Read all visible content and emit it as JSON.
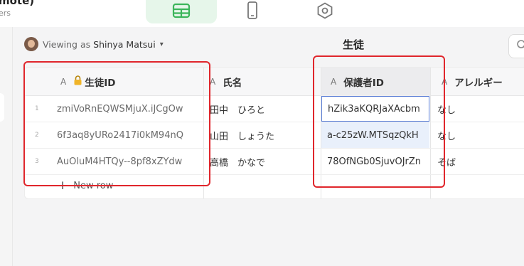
{
  "app": {
    "title": "mote)",
    "subtitle": "ers"
  },
  "tabs": [
    {
      "icon": "table-icon",
      "selected": true
    },
    {
      "icon": "mobile-icon",
      "selected": false
    },
    {
      "icon": "settings-icon",
      "selected": false
    }
  ],
  "viewer": {
    "prefix": "Viewing as",
    "name": "Shinya Matsui"
  },
  "table_title": "生徒",
  "columns": [
    {
      "type_glyph": "A",
      "label": "生徒ID",
      "locked": true
    },
    {
      "type_glyph": "A",
      "label": "氏名"
    },
    {
      "type_glyph": "A",
      "label": "保護者ID"
    },
    {
      "type_glyph": "A",
      "label": "アレルギー"
    }
  ],
  "rows": [
    {
      "num": "1",
      "student_id": "zmiVoRnEQWSMjuX.iJCgOw",
      "name": "田中　ひろと",
      "guardian_id": "hZik3aKQRJaXAcbm",
      "allergy": "なし"
    },
    {
      "num": "2",
      "student_id": "6f3aq8yURo2417i0kM94nQ",
      "name": "山田　しょうた",
      "guardian_id": "a-c25zW.MTSqzQkH",
      "allergy": "なし"
    },
    {
      "num": "3",
      "student_id": "AuOluM4HTQy--8pf8xZYdw",
      "name": "高橋　かなで",
      "guardian_id": "78OfNGb0SjuvOJrZn",
      "allergy": "そば"
    }
  ],
  "new_row_label": "New row",
  "colors": {
    "accent_green": "#e6f6ea",
    "annotation_red": "#e0262c",
    "selection_blue": "#5b7fd6"
  }
}
